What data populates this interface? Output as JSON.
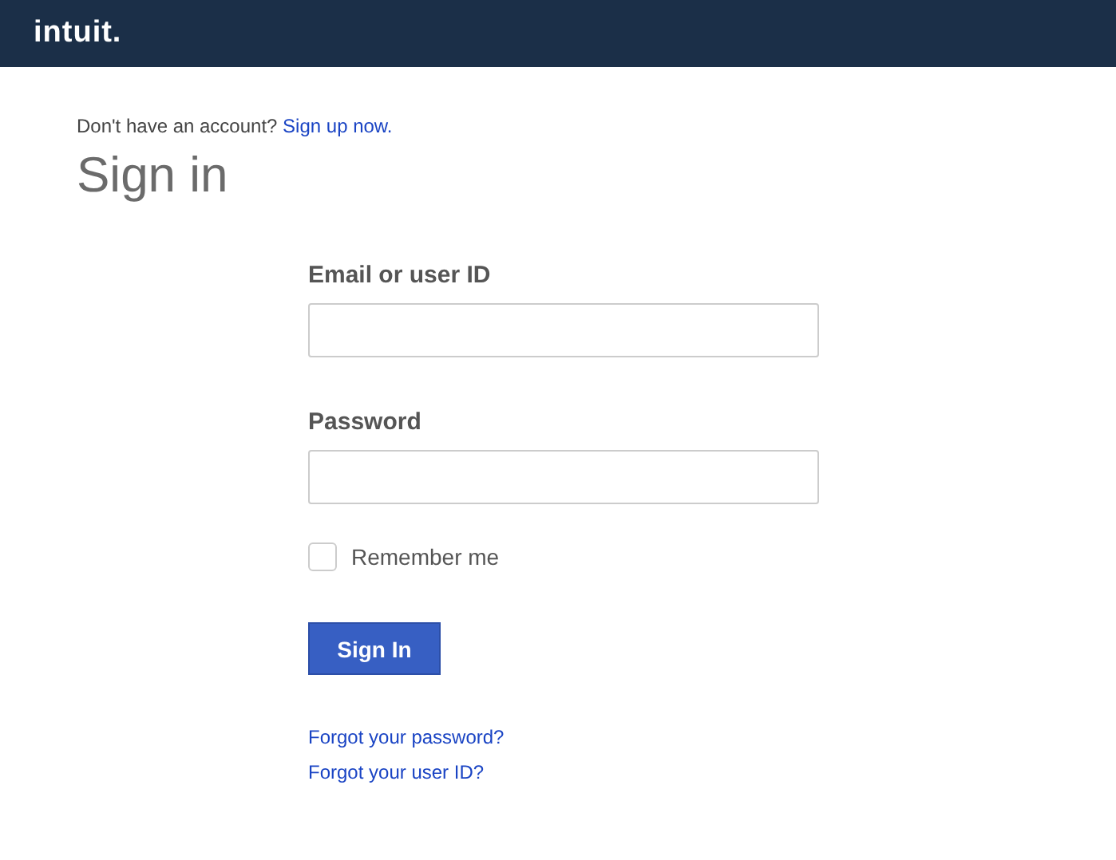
{
  "header": {
    "logo": "intuit."
  },
  "signup_prompt": {
    "text": "Don't have an account?",
    "link": "Sign up now."
  },
  "title": "Sign in",
  "fields": [
    {
      "label": "Email or user ID"
    },
    {
      "label": "Password"
    }
  ],
  "remember": {
    "label": "Remember me",
    "checked": false
  },
  "submit": "Sign In",
  "links": [
    "Forgot your password?",
    "Forgot your user ID?"
  ]
}
